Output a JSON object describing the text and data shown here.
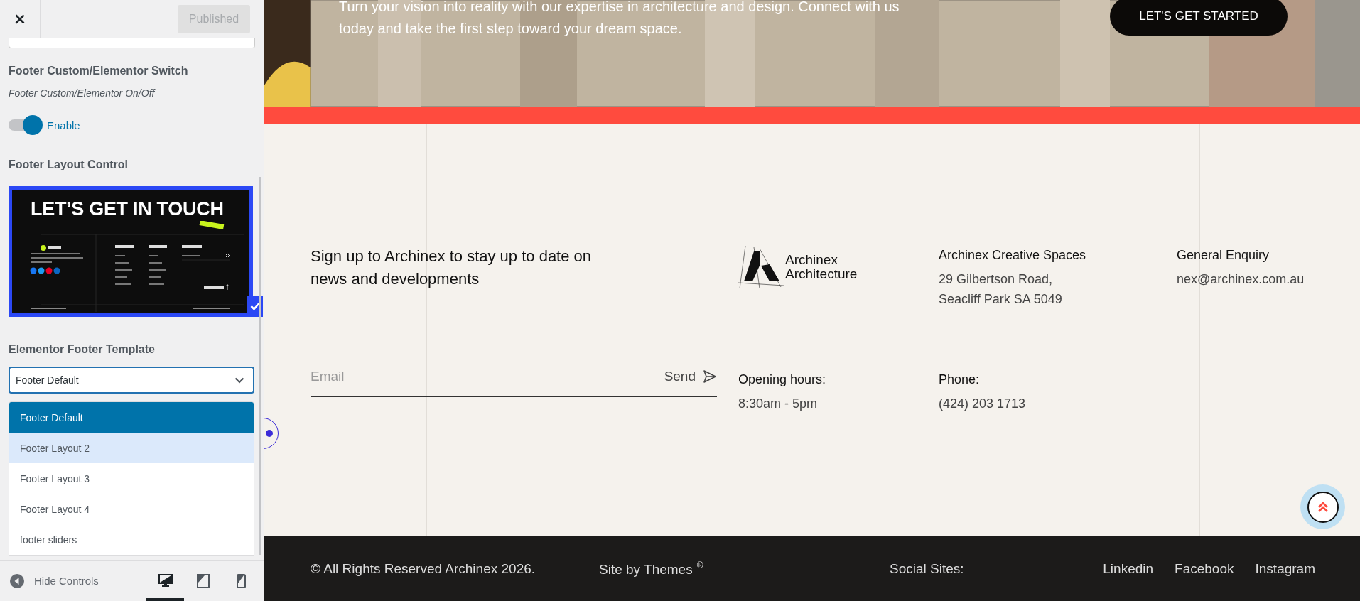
{
  "panel": {
    "publish_button": {
      "label": "Published",
      "disabled": true
    },
    "switch_section": {
      "title": "Footer Custom/Elementor Switch",
      "description": "Footer Custom/Elementor On/Off",
      "toggle": {
        "label": "Enable",
        "on": true
      }
    },
    "layout_section": {
      "title": "Footer Layout Control",
      "layouts": [
        {
          "selected": true,
          "preview": {
            "heading": "LET’S GET IN TOUCH"
          }
        }
      ]
    },
    "template_section": {
      "title": "Elementor Footer Template",
      "value": "Footer Default",
      "expanded": true,
      "options": [
        {
          "label": "Footer Default",
          "selected": true,
          "hovered": false
        },
        {
          "label": "Footer Layout 2",
          "selected": false,
          "hovered": true
        },
        {
          "label": "Footer Layout 3",
          "selected": false,
          "hovered": false
        },
        {
          "label": "Footer Layout 4",
          "selected": false,
          "hovered": false
        },
        {
          "label": "footer sliders",
          "selected": false,
          "hovered": false
        }
      ]
    },
    "hide_controls": "Hide Controls",
    "devices": [
      {
        "kind": "desktop",
        "selected": true
      },
      {
        "kind": "tablet",
        "selected": false
      },
      {
        "kind": "mobile",
        "selected": false
      }
    ]
  },
  "preview": {
    "hero": {
      "text_lines": [
        "Turn your vision into reality with our expertise in architecture and design. Connect with us",
        "today and take the first step toward your dream space."
      ],
      "button": "LET'S GET STARTED"
    },
    "footer": {
      "signup": "Sign up to Archinex to stay up to date on news and developments",
      "email_placeholder": "Email",
      "send": "Send",
      "logo": {
        "line1": "Archinex",
        "line2": "Architecture"
      },
      "info_blocks": [
        {
          "heading": "Archinex Creative Spaces",
          "lines": [
            "29 Gilbertson Road,",
            "Seacliff Park SA 5049"
          ]
        },
        {
          "heading": "General Enquiry",
          "lines": [
            "nex@archinex.com.au"
          ]
        },
        {
          "heading": "Opening hours:",
          "lines": [
            "8:30am - 5pm"
          ]
        },
        {
          "heading": "Phone:",
          "lines": [
            "(424) 203 1713"
          ]
        }
      ]
    },
    "bottom_bar": {
      "copyright": "© All Rights Reserved Archinex 2026.",
      "credit": "Site by Themes",
      "credit_mark": "®",
      "social_label": "Social Sites:",
      "social_links": [
        "Linkedin",
        "Facebook",
        "Instagram"
      ]
    }
  }
}
